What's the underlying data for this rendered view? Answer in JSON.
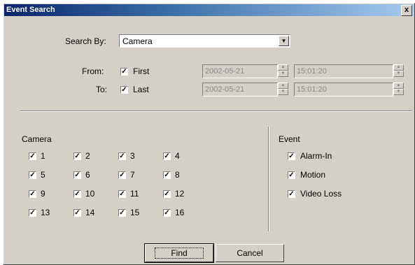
{
  "window": {
    "title": "Event Search",
    "close_glyph": "x"
  },
  "search_by": {
    "label": "Search By:",
    "value": "Camera"
  },
  "from": {
    "label": "From:",
    "option_label": "First",
    "checked": true,
    "date": "2002-05-21",
    "time": "15:01:20"
  },
  "to": {
    "label": "To:",
    "option_label": "Last",
    "checked": true,
    "date": "2002-05-21",
    "time": "15:01:20"
  },
  "camera": {
    "title": "Camera",
    "items": [
      {
        "label": "1",
        "checked": true
      },
      {
        "label": "2",
        "checked": true
      },
      {
        "label": "3",
        "checked": true
      },
      {
        "label": "4",
        "checked": true
      },
      {
        "label": "5",
        "checked": true
      },
      {
        "label": "6",
        "checked": true
      },
      {
        "label": "7",
        "checked": true
      },
      {
        "label": "8",
        "checked": true
      },
      {
        "label": "9",
        "checked": true
      },
      {
        "label": "10",
        "checked": true
      },
      {
        "label": "11",
        "checked": true
      },
      {
        "label": "12",
        "checked": true
      },
      {
        "label": "13",
        "checked": true
      },
      {
        "label": "14",
        "checked": true
      },
      {
        "label": "15",
        "checked": true
      },
      {
        "label": "16",
        "checked": true
      }
    ]
  },
  "event": {
    "title": "Event",
    "items": [
      {
        "label": "Alarm-In",
        "checked": true
      },
      {
        "label": "Motion",
        "checked": true
      },
      {
        "label": "Video Loss",
        "checked": true
      }
    ]
  },
  "buttons": {
    "find": "Find",
    "cancel": "Cancel"
  },
  "check_glyph": "✓"
}
